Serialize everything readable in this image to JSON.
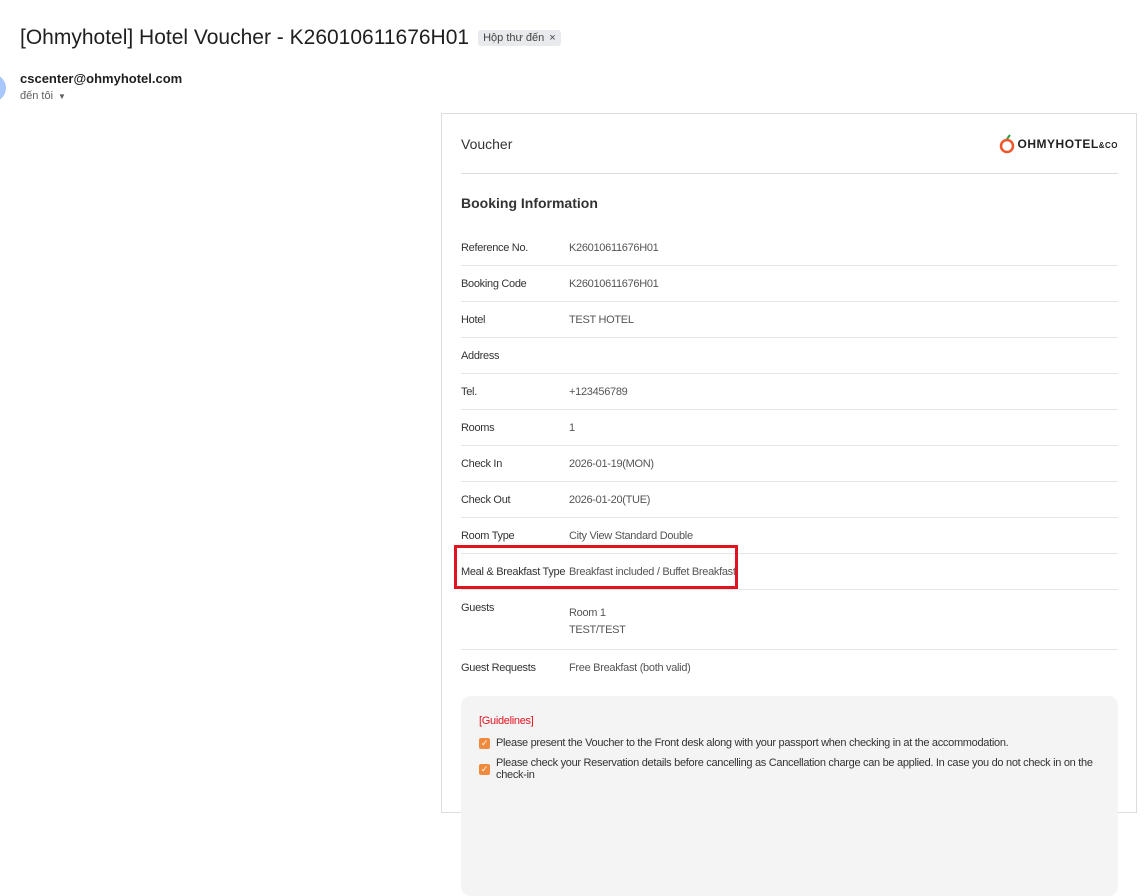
{
  "email": {
    "subject": "[Ohmyhotel] Hotel Voucher - K26010611676H01",
    "label": "Hộp thư đến",
    "sender": "cscenter@ohmyhotel.com",
    "to": "đến tôi"
  },
  "voucher": {
    "title": "Voucher",
    "logo": "OHMYHOTEL&CO",
    "section": "Booking Information",
    "rows": [
      {
        "label": "Reference No.",
        "value": "K26010611676H01"
      },
      {
        "label": "Booking Code",
        "value": "K26010611676H01"
      },
      {
        "label": "Hotel",
        "value": "TEST HOTEL"
      },
      {
        "label": "Address",
        "value": ""
      },
      {
        "label": "Tel.",
        "value": "+123456789"
      },
      {
        "label": "Rooms",
        "value": "1"
      },
      {
        "label": "Check In",
        "value": "2026-01-19(MON)"
      },
      {
        "label": "Check Out",
        "value": "2026-01-20(TUE)"
      },
      {
        "label": "Room Type",
        "value": "City View Standard Double"
      },
      {
        "label": "Meal & Breakfast Type",
        "value": "Breakfast included / Buffet Breakfast"
      },
      {
        "label": "Guests",
        "value": "Room 1",
        "value2": "TEST/TEST"
      },
      {
        "label": "Guest Requests",
        "value": "Free Breakfast (both valid)"
      }
    ],
    "guidelines": {
      "title": "[Guidelines]",
      "items": [
        "Please present the Voucher to the Front desk along with your passport when checking in at the accommodation.",
        "Please check your Reservation details before cancelling as Cancellation charge can be applied. In case you do not check in on the check-in"
      ]
    }
  }
}
